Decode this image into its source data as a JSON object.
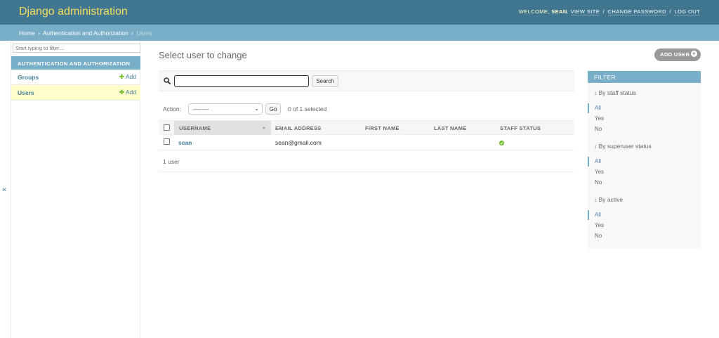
{
  "header": {
    "site_name": "Django administration",
    "welcome": "WELCOME,",
    "username": "SEAN",
    "view_site": "VIEW SITE",
    "change_password": "CHANGE PASSWORD",
    "log_out": "LOG OUT",
    "separator": "/"
  },
  "breadcrumbs": {
    "home": "Home",
    "app": "Authentication and Authorization",
    "current": "Users",
    "arrow": "›"
  },
  "sidebar": {
    "filter_placeholder": "Start typing to filter…",
    "app_caption": "AUTHENTICATION AND AUTHORIZATION",
    "models": [
      {
        "label": "Groups",
        "add": "Add",
        "current": false
      },
      {
        "label": "Users",
        "add": "Add",
        "current": true
      }
    ],
    "toggle": "«"
  },
  "content": {
    "title": "Select user to change",
    "add_button": "ADD USER",
    "search_button": "Search",
    "search_value": "",
    "action_label": "Action:",
    "action_selected": "---------",
    "go_button": "Go",
    "selected_count": "0 of 1 selected",
    "columns": [
      "USERNAME",
      "EMAIL ADDRESS",
      "FIRST NAME",
      "LAST NAME",
      "STAFF STATUS"
    ],
    "rows": [
      {
        "username": "sean",
        "email": "sean@gmail.com",
        "first_name": "",
        "last_name": "",
        "staff_status": true
      }
    ],
    "result_count": "1 user"
  },
  "filter": {
    "title": "FILTER",
    "groups": [
      {
        "title": "↓ By staff status",
        "options": [
          "All",
          "Yes",
          "No"
        ],
        "selected": "All"
      },
      {
        "title": "↓ By superuser status",
        "options": [
          "All",
          "Yes",
          "No"
        ],
        "selected": "All"
      },
      {
        "title": "↓ By active",
        "options": [
          "All",
          "Yes",
          "No"
        ],
        "selected": "All"
      }
    ]
  },
  "colors": {
    "header_bg": "#417690",
    "breadcrumb_bg": "#79aec8",
    "brand_yellow": "#f5dd5d",
    "link": "#447e9b",
    "add_green": "#70bf2b",
    "current_row": "#ffffcc"
  }
}
